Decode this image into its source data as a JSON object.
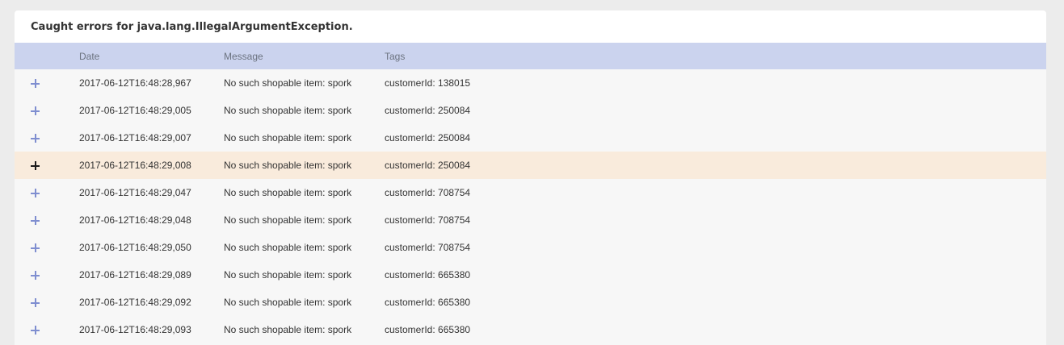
{
  "panel": {
    "title": "Caught errors for java.lang.IllegalArgumentException."
  },
  "table": {
    "columns": {
      "date": "Date",
      "message": "Message",
      "tags": "Tags"
    },
    "rows": [
      {
        "date": "2017-06-12T16:48:28,967",
        "message": "No such shopable item: spork",
        "tags": "customerId: 138015",
        "highlighted": false
      },
      {
        "date": "2017-06-12T16:48:29,005",
        "message": "No such shopable item: spork",
        "tags": "customerId: 250084",
        "highlighted": false
      },
      {
        "date": "2017-06-12T16:48:29,007",
        "message": "No such shopable item: spork",
        "tags": "customerId: 250084",
        "highlighted": false
      },
      {
        "date": "2017-06-12T16:48:29,008",
        "message": "No such shopable item: spork",
        "tags": "customerId: 250084",
        "highlighted": true
      },
      {
        "date": "2017-06-12T16:48:29,047",
        "message": "No such shopable item: spork",
        "tags": "customerId: 708754",
        "highlighted": false
      },
      {
        "date": "2017-06-12T16:48:29,048",
        "message": "No such shopable item: spork",
        "tags": "customerId: 708754",
        "highlighted": false
      },
      {
        "date": "2017-06-12T16:48:29,050",
        "message": "No such shopable item: spork",
        "tags": "customerId: 708754",
        "highlighted": false
      },
      {
        "date": "2017-06-12T16:48:29,089",
        "message": "No such shopable item: spork",
        "tags": "customerId: 665380",
        "highlighted": false
      },
      {
        "date": "2017-06-12T16:48:29,092",
        "message": "No such shopable item: spork",
        "tags": "customerId: 665380",
        "highlighted": false
      },
      {
        "date": "2017-06-12T16:48:29,093",
        "message": "No such shopable item: spork",
        "tags": "customerId: 665380",
        "highlighted": false
      }
    ]
  },
  "colors": {
    "header_row": "#cbd3ee",
    "highlight_row": "#f9ebdc",
    "expand_icon": "#7f8ed0"
  },
  "icons": {
    "expand": "plus-icon"
  }
}
